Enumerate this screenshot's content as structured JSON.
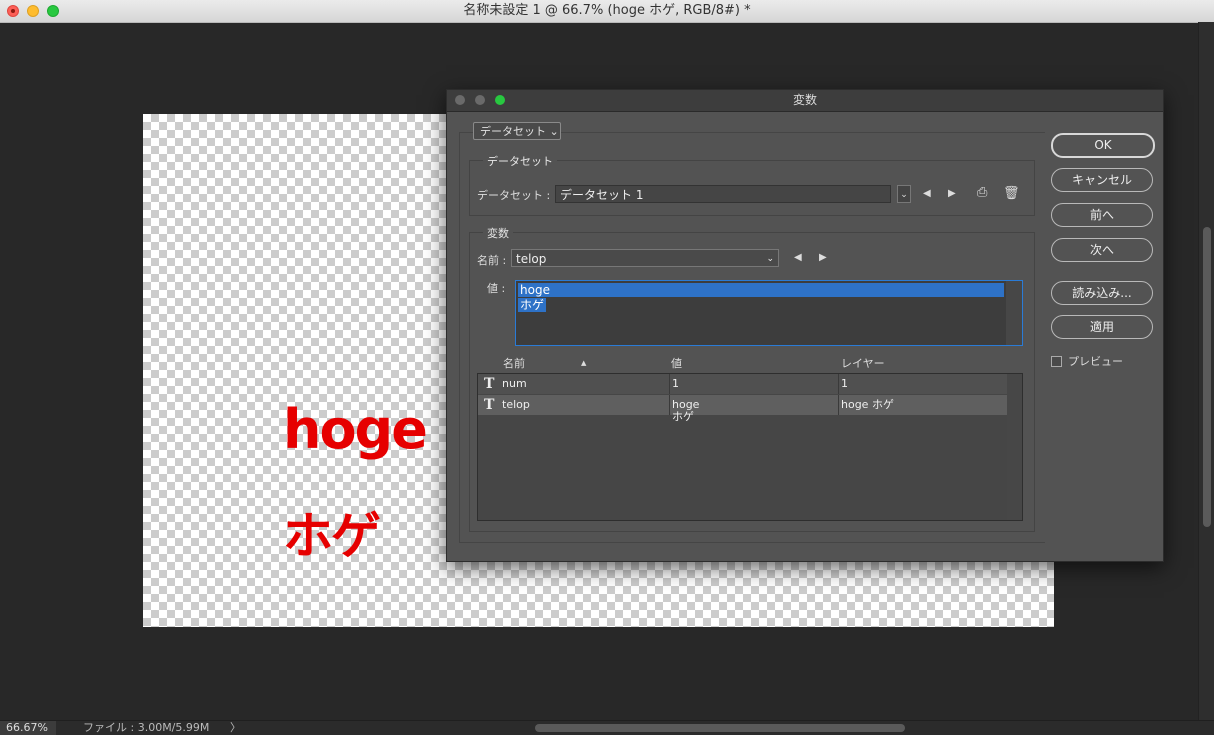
{
  "window": {
    "title": "名称未設定 1 @ 66.7% (hoge ホゲ, RGB/8#) *"
  },
  "canvas": {
    "line1": "hoge",
    "line2": "ホゲ",
    "text_color": "#e60000"
  },
  "status": {
    "zoom": "66.67%",
    "file_info": "ファイル : 3.00M/5.99M",
    "arrow": "〉"
  },
  "dialog": {
    "title": "変数",
    "mode_dropdown": "データセット ⌄",
    "dataset_group_label": "データセット",
    "dataset_field_label": "データセット :",
    "dataset_value": "データセット 1",
    "variable_group_label": "変数",
    "name_label": "名前 :",
    "name_value": "telop",
    "value_label": "値 :",
    "value_line1": "hoge",
    "value_line2": "ホゲ",
    "table": {
      "headers": [
        "名前",
        "値",
        "レイヤー"
      ],
      "sort_arrow": "▲",
      "rows": [
        {
          "icon": "T",
          "name": "num",
          "value": "1",
          "value2": "",
          "layer": "1"
        },
        {
          "icon": "T",
          "name": "telop",
          "value": "hoge",
          "value2": "ホゲ",
          "layer": "hoge ホゲ"
        }
      ]
    },
    "buttons": {
      "ok": "OK",
      "cancel": "キャンセル",
      "prev": "前へ",
      "next": "次へ",
      "load": "読み込み...",
      "apply": "適用"
    },
    "preview_label": "プレビュー"
  }
}
